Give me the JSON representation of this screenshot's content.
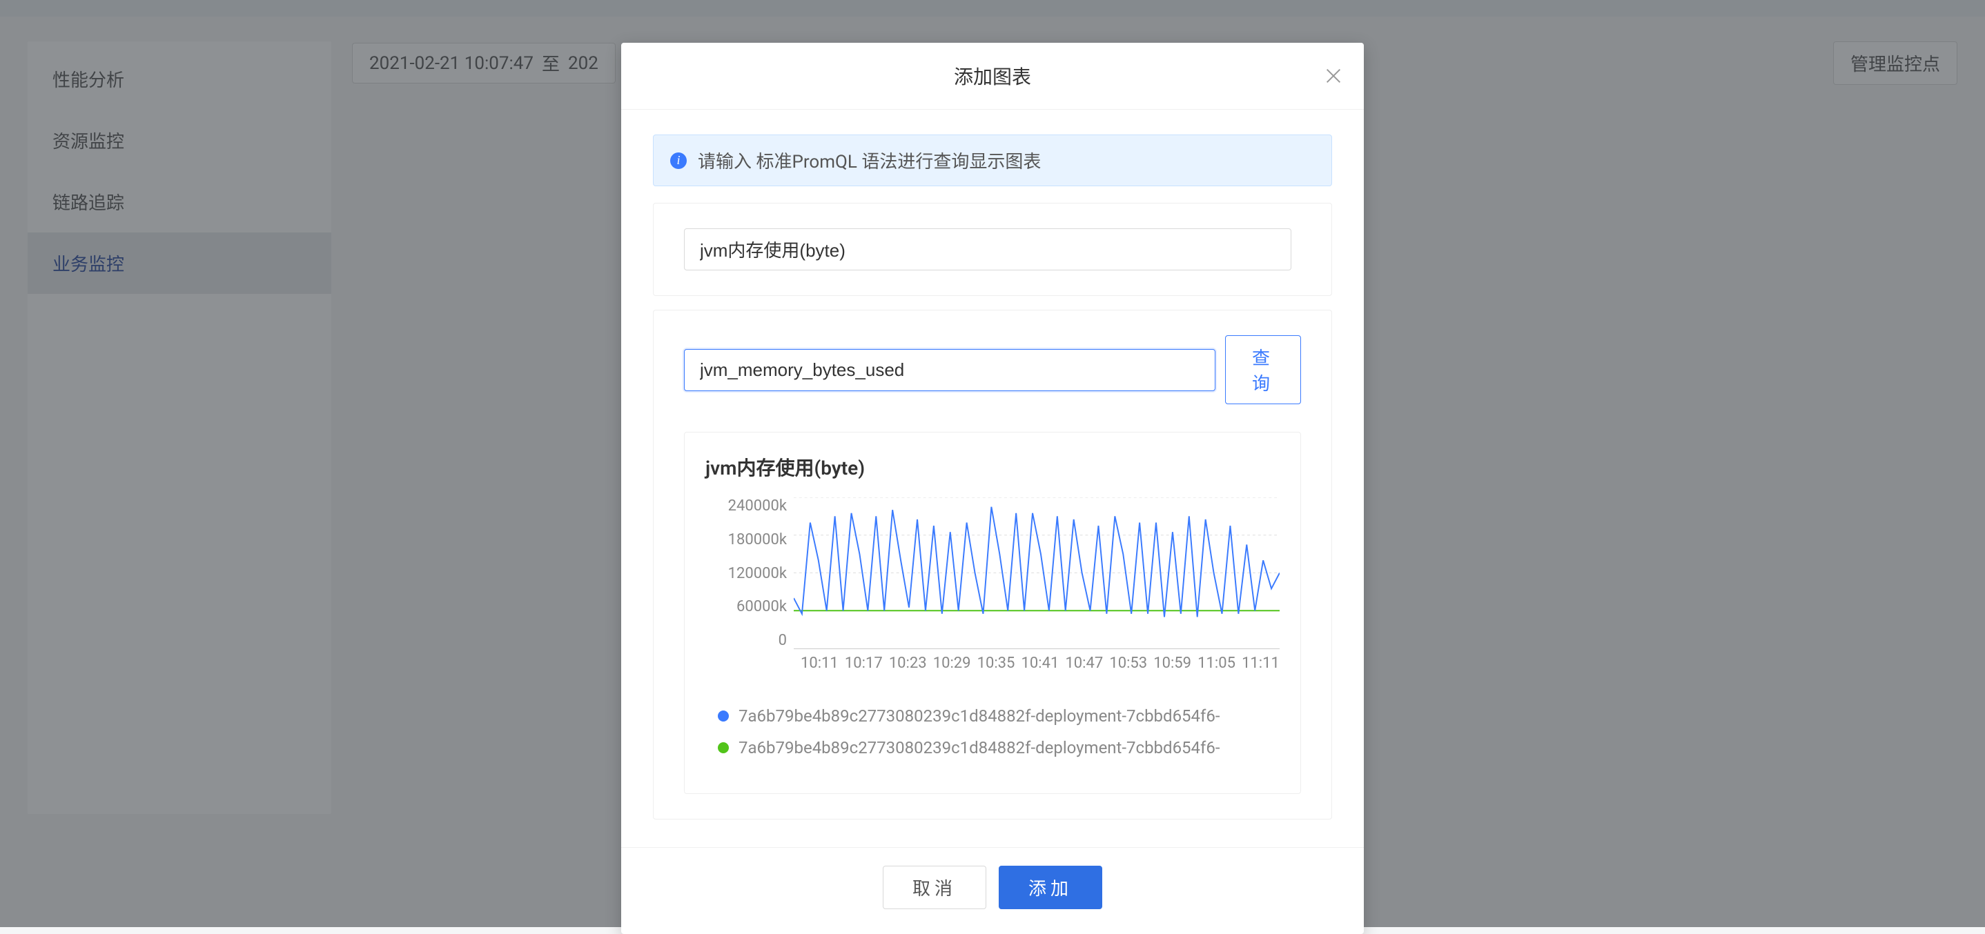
{
  "sidebar": {
    "items": [
      {
        "label": "性能分析"
      },
      {
        "label": "资源监控"
      },
      {
        "label": "链路追踪"
      },
      {
        "label": "业务监控"
      }
    ],
    "active_index": 3
  },
  "toolbar": {
    "datetime_start": "2021-02-21 10:07:47",
    "datetime_to": "至",
    "datetime_end_trunc": "202",
    "manage_label": "管理监控点"
  },
  "modal": {
    "title": "添加图表",
    "info_text": "请输入 标准PromQL 语法进行查询显示图表",
    "chart_name_value": "jvm内存使用(byte)",
    "query_value": "jvm_memory_bytes_used",
    "query_button": "查询",
    "cancel_label": "取消",
    "confirm_label": "添加"
  },
  "chart_data": {
    "type": "line",
    "title": "jvm内存使用(byte)",
    "xlabel": "",
    "ylabel": "",
    "y_ticks": [
      "240000k",
      "180000k",
      "120000k",
      "60000k",
      "0"
    ],
    "ylim": [
      0,
      240000
    ],
    "x_ticks": [
      "10:11",
      "10:17",
      "10:23",
      "10:29",
      "10:35",
      "10:41",
      "10:47",
      "10:53",
      "10:59",
      "11:05",
      "11:11"
    ],
    "series": [
      {
        "name": "7a6b79be4b89c2773080239c1d84882f-deployment-7cbbd654f6-",
        "color": "#3a7afe",
        "values": [
          80000,
          55000,
          200000,
          140000,
          60000,
          210000,
          60000,
          215000,
          150000,
          60000,
          210000,
          60000,
          220000,
          140000,
          65000,
          205000,
          60000,
          195000,
          55000,
          185000,
          60000,
          200000,
          120000,
          55000,
          225000,
          150000,
          60000,
          215000,
          60000,
          215000,
          150000,
          60000,
          210000,
          60000,
          205000,
          120000,
          60000,
          195000,
          55000,
          210000,
          150000,
          55000,
          200000,
          55000,
          200000,
          50000,
          185000,
          55000,
          210000,
          50000,
          205000,
          120000,
          55000,
          195000,
          55000,
          165000,
          60000,
          140000,
          95000,
          120000
        ]
      },
      {
        "name": "7a6b79be4b89c2773080239c1d84882f-deployment-7cbbd654f6-",
        "color": "#52c41a",
        "values": [
          60000,
          60000,
          60000,
          60000,
          60000,
          60000,
          60000,
          60000,
          60000,
          60000,
          60000,
          60000,
          60000,
          60000,
          60000,
          60000,
          60000,
          60000,
          60000,
          60000,
          60000,
          60000,
          60000,
          60000,
          60000,
          60000,
          60000,
          60000,
          60000,
          60000,
          60000,
          60000,
          60000,
          60000,
          60000,
          60000,
          60000,
          60000,
          60000,
          60000,
          60000,
          60000,
          60000,
          60000,
          60000,
          60000,
          60000,
          60000,
          60000,
          60000,
          60000,
          60000,
          60000,
          60000,
          60000,
          60000,
          60000,
          60000,
          60000,
          60000
        ]
      }
    ]
  }
}
